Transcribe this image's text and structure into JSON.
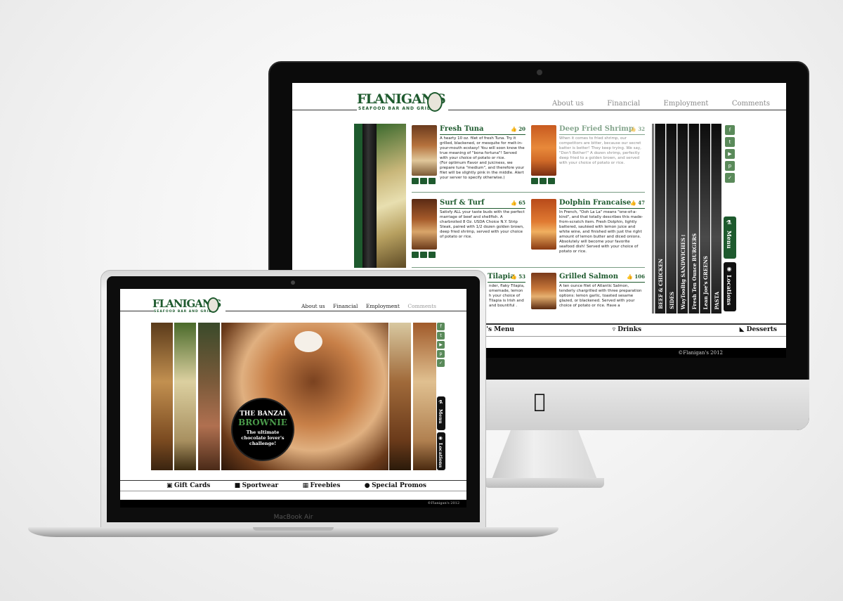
{
  "brand": {
    "logo_text": "FLANIGAN'S",
    "logo_subtitle": "SEAFOOD BAR AND GRILL"
  },
  "imac": {
    "nav": [
      "About us",
      "Financial",
      "Employment",
      "Comments"
    ],
    "menu_items": [
      {
        "title": "Fresh Tuna",
        "likes": "20",
        "description": "A hearty 10 oz. filet of fresh Tuna. Try it grilled, blackened, or mesquite for melt-in-your-mouth ecstasy! You will soon know the true meaning of \"bona fortuna\"! Served with your choice of potato or rice.",
        "note": "(For optimum flavor and juiciness, we prepare tuna \"medium\", and therefore your filet will be slightly pink in the middle. Alert your server to specify otherwise.)"
      },
      {
        "title": "Deep Fried Shrimp",
        "likes": "32",
        "description": "When it comes to fried shrimp, our competitors are bitter, because our secret batter is better! They keep trying. We say, \"Don't Bother!\" A dozen shrimp, perfectly deep fried to a golden brown, and served with your choice of potato or rice."
      },
      {
        "title": "Surf & Turf",
        "likes": "65",
        "description": "Satisfy ALL your taste buds with the perfect marriage of beef and shellfish. A charbroiled 8 Oz. USDA Choice N.Y. Strip Steak, paired with 1/2 dozen golden brown, deep fried shrimp, served with your choice of potato or rice."
      },
      {
        "title": "Dolphin Francaise",
        "likes": "47",
        "description": "In French, \"Ooh La La\" means \"one-of-a-kind\", and that totally describes this made- from-scratch item. Fresh Dolphin, lightly battered, sautéed with lemon juice and white wine, and finished with just the right amount of lemon butter and diced onions. Absolutely will become your favorite seafood dish! Served with your choice of potato or rice."
      },
      {
        "title": "Tilapia",
        "likes": "53",
        "description": "nder, flaky Tilapia, omemade, lemon h your choice of Tilapia is Irish and and bountiful ."
      },
      {
        "title": "Grilled Salmon",
        "likes": "106",
        "description": "A ten ounce filet of Atlantic Salmon, tenderly chargrilled with three preparation options: lemon garlic, toasted sesame glazed, or blackened. Served with your choice of potato or rice. Have a"
      }
    ],
    "categories": [
      "BEEF & CHICKEN",
      "SIDES",
      "WayTooBig SANDWICHES™",
      "Fresh Ten Ounce BURGERS",
      "Lean Joe's GREENS",
      "PASTA"
    ],
    "social_icons": [
      "facebook-icon",
      "twitter-icon",
      "youtube-icon",
      "pinterest-icon",
      "foursquare-icon"
    ],
    "side_tabs": [
      "Menu",
      "Locations"
    ],
    "bottom_nav": [
      "d's Menu",
      "Drinks",
      "Desserts"
    ],
    "copyright": "©Flanigan's 2012"
  },
  "macbook": {
    "nav": [
      "About us",
      "Financial",
      "Employment",
      "Comments"
    ],
    "hero_title": "THE BANZAI",
    "hero_highlight": "BROWNIE",
    "hero_tagline": "The ultimate chocolate lover's challenge!",
    "side_tabs": [
      "Menu",
      "Locations"
    ],
    "bottom_nav": [
      "Gift Cards",
      "Sportwear",
      "Freebies",
      "Special Promos"
    ],
    "copyright": "©Flanigan's 2012",
    "device_label": "MacBook Air"
  },
  "colors": {
    "brand_green": "#1e5a2e",
    "dark": "#0b0b0b"
  }
}
